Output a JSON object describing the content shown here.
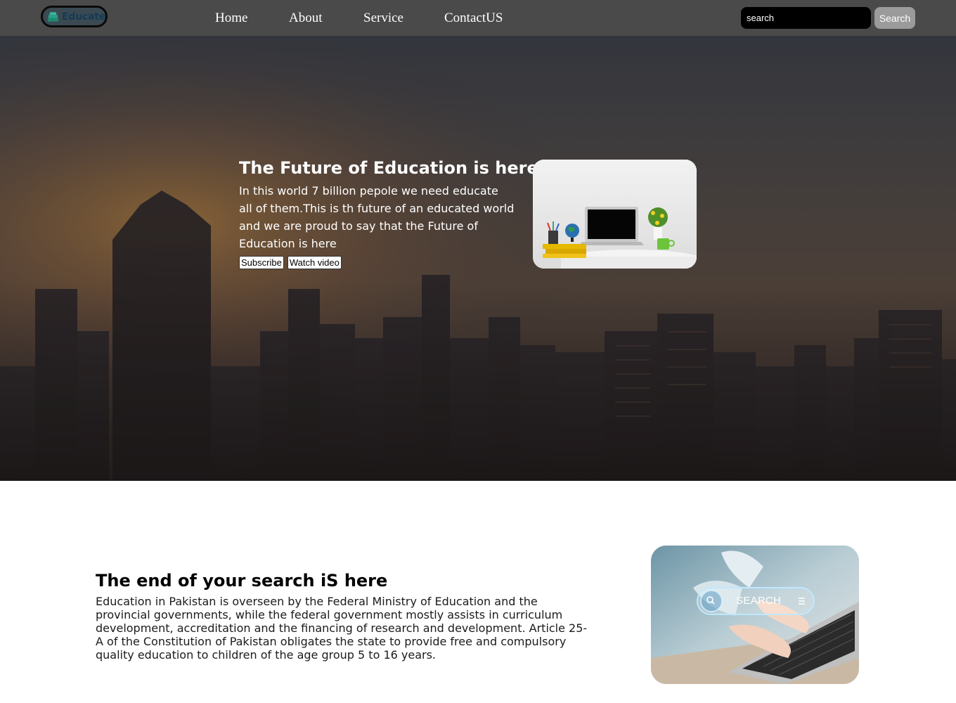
{
  "navbar": {
    "logo_text": "Educate",
    "links": [
      "Home",
      "About",
      "Service",
      "ContactUS"
    ],
    "search_placeholder": "search",
    "search_button": "Search"
  },
  "hero": {
    "title": "The Future of Education is here",
    "text": "In this world 7 billion pepole we need educate all of them.This is th future of an educated world and we are proud to say that the Future of Education is here",
    "buttons": {
      "subscribe": "Subscribe",
      "watch": "Watch video"
    }
  },
  "section": {
    "title": "The end of your search iS here",
    "text": "Education in Pakistan is overseen by the Federal Ministry of Education and the provincial governments, while the federal government mostly assists in curriculum development, accreditation and the financing of research and development. Article 25-A of the Constitution of Pakistan obligates the state to provide free and compulsory quality education to children of the age group 5 to 16 years.",
    "image_search_label": "SEARCH"
  },
  "icons": {
    "logo": "books-stack-icon",
    "image_search": "magnifier-icon",
    "image_menu": "hamburger-icon"
  },
  "colors": {
    "navbar_bg": "#4a4a4a",
    "search_input_bg": "#000000",
    "search_button_bg": "#9b9b9b",
    "hero_overlay": "#2b2b2f"
  }
}
